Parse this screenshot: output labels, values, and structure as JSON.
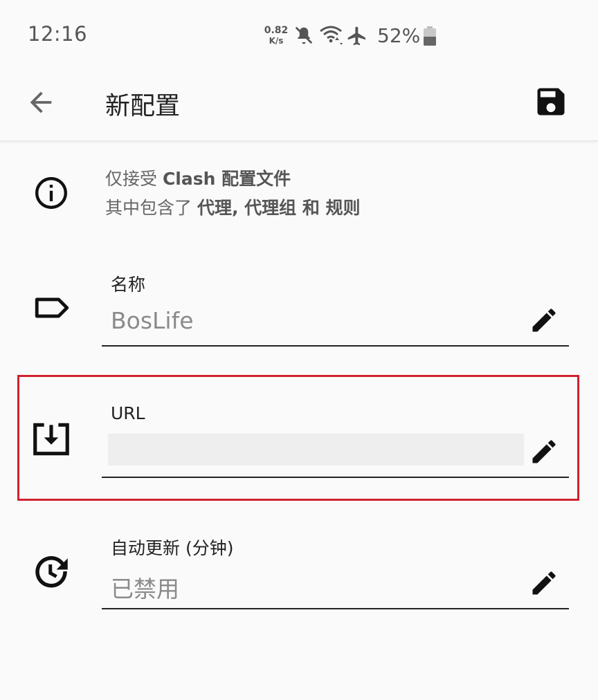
{
  "status_bar": {
    "time": "12:16",
    "net_speed_value": "0.82",
    "net_speed_unit": "K/s",
    "battery_percent": "52%",
    "icons": [
      "mute-icon",
      "wifi-icon",
      "airplane-icon",
      "battery-icon"
    ]
  },
  "app_bar": {
    "title": "新配置",
    "back_icon": "arrow-back-icon",
    "save_icon": "save-icon"
  },
  "info": {
    "line1_prefix": "仅接受 ",
    "line1_bold": "Clash 配置文件",
    "line2_prefix": "其中包含了 ",
    "line2_bold": "代理, 代理组 和 规则"
  },
  "fields": {
    "name": {
      "label": "名称",
      "value": "BosLife"
    },
    "url": {
      "label": "URL",
      "value": ""
    },
    "auto_update": {
      "label": "自动更新 (分钟)",
      "value": "已禁用"
    }
  },
  "colors": {
    "background": "#fafafa",
    "text": "#1f1f1f",
    "secondary_text": "#8a8a8a",
    "highlight": "#d0222e"
  }
}
